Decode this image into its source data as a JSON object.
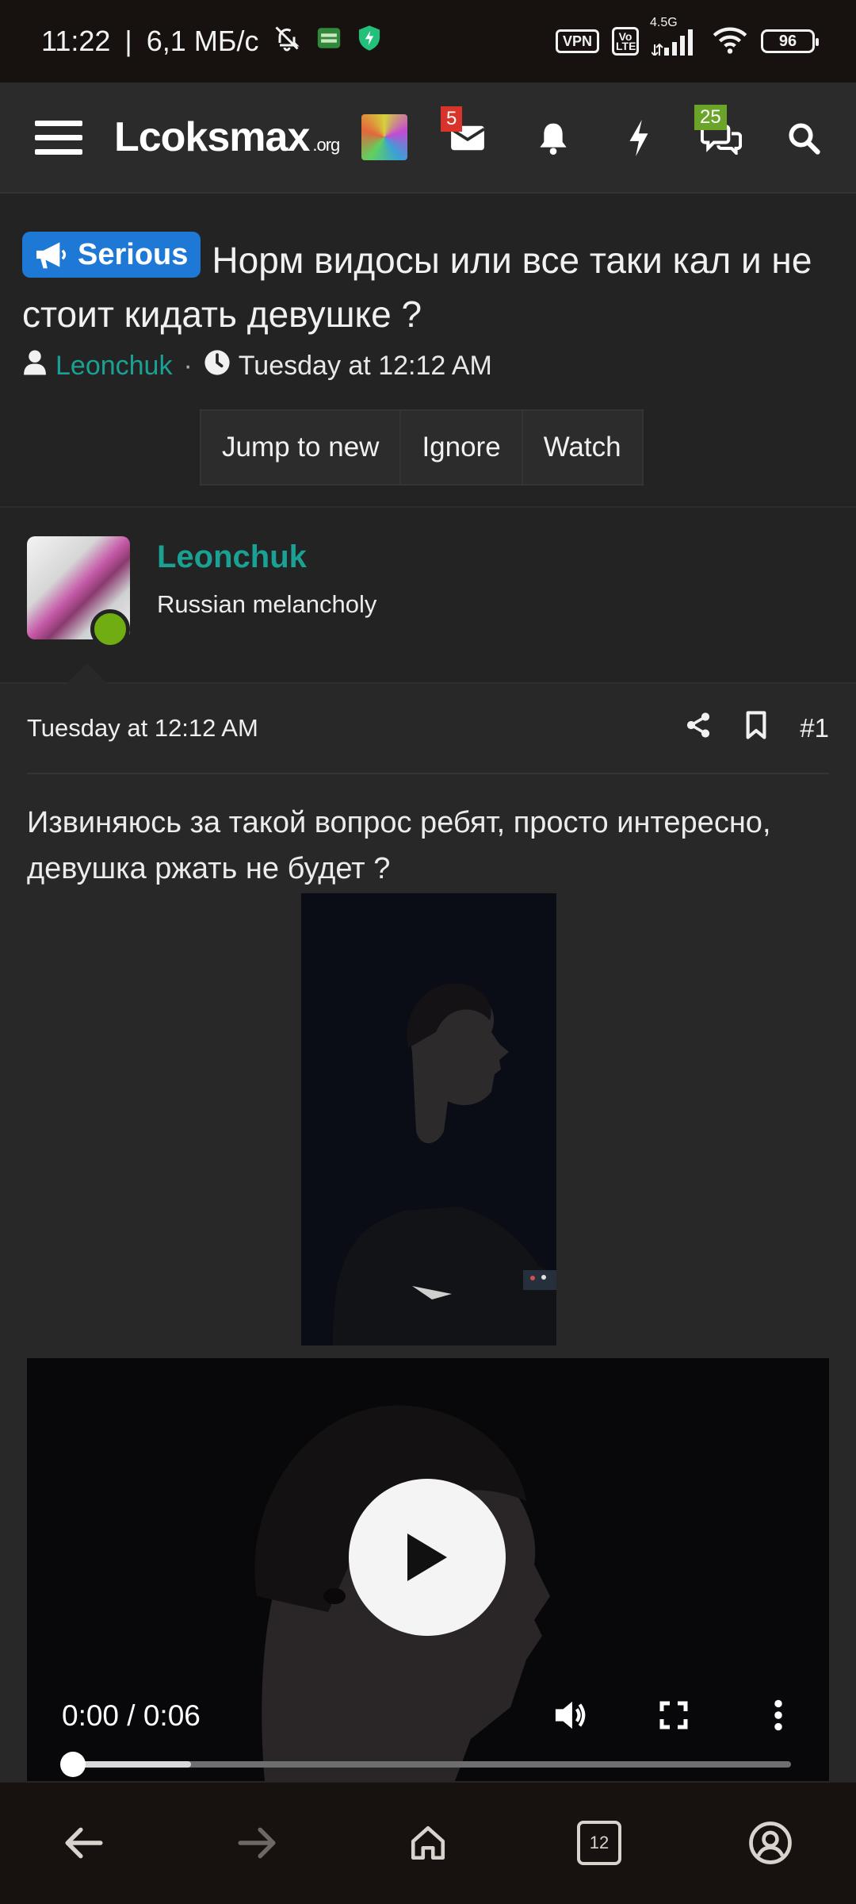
{
  "status_bar": {
    "time": "11:22",
    "speed": "6,1 МБ/с",
    "icons": [
      "mute-bell-icon",
      "app-notification-icon",
      "shield-icon"
    ],
    "vpn": "VPN",
    "volte": "Vo LTE",
    "network": "4.5G",
    "battery": "96"
  },
  "header": {
    "logo_main": "Lcoksmax",
    "logo_suffix": ".org",
    "inbox_count": "5",
    "conversations_count": "25"
  },
  "thread": {
    "prefix": "Serious",
    "title": "Норм видосы или все таки кал и не стоит кидать девушке ?",
    "author": "Leonchuk",
    "separator": "·",
    "date": "Tuesday at 12:12 AM",
    "buttons": [
      "Jump to new",
      "Ignore",
      "Watch"
    ]
  },
  "user": {
    "name": "Leonchuk",
    "title": "Russian melancholy"
  },
  "post": {
    "date": "Tuesday at 12:12 AM",
    "number": "#1",
    "text": "Извиняюсь за такой вопрос ребят, просто интересно, девушка ржать не будет ?",
    "video": {
      "time": "0:00 / 0:06",
      "buffered_fraction": 0.165,
      "played_fraction": 0.0
    }
  },
  "browser_nav": {
    "tab_count": "12"
  },
  "colors": {
    "accent_teal": "#1aa193",
    "label_blue": "#1d78d6",
    "badge_red": "#d9342b",
    "badge_green": "#6aa52a",
    "online_green": "#70ad12"
  }
}
